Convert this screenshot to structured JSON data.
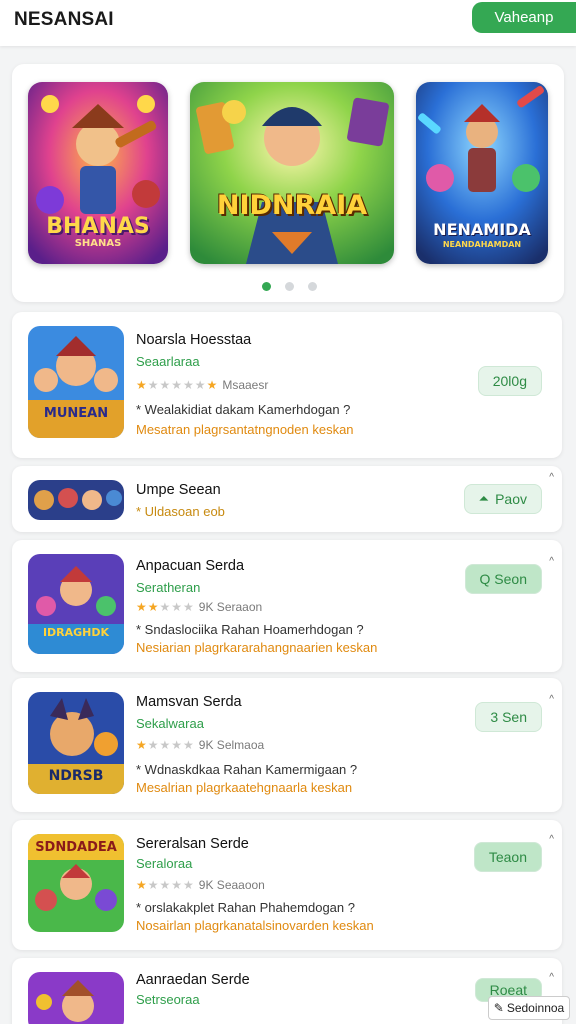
{
  "header": {
    "title": "NESANSAI",
    "action_label": "Vaheanp"
  },
  "carousel": {
    "slides": [
      {
        "text": "BHANAS",
        "subtext": "SHANAS"
      },
      {
        "text": "NIDNRAIA",
        "subtext": ""
      },
      {
        "text": "NENAMIDA",
        "subtext": "NEANDAHAMDAN"
      }
    ],
    "dots": 3,
    "active_dot": 0
  },
  "list": [
    {
      "title": "Noarsla Hoesstaa",
      "subtitle": "Seaarlaraa",
      "rating_stars": "★★★★★★★",
      "rating_text": "Msaaesr",
      "description": "* Wealakidiat dakam Kamerhdogan ?",
      "link": "Mesatran plagrsantatngnoden keskan",
      "action": "20l0g",
      "thumb_text": "MUNEAN"
    },
    {
      "title": "Umpe Seean",
      "subtitle": "* Uldasoan eob",
      "action": "Paov",
      "action_icon": "upload-icon",
      "thumb_text": ""
    },
    {
      "title": "Anpacuan Serda",
      "subtitle": "Seratheran",
      "rating_stars": "★★★★★",
      "rating_text": "9K Seraaon",
      "description": "* Sndaslociika Rahan Hoamerhdogan ?",
      "link": "Nesiarian plagrkararahangnaarien keskan",
      "action": "Q Seon",
      "thumb_text": "IDRAGHDK"
    },
    {
      "title": "Mamsvan Serda",
      "subtitle": "Sekalwaraa",
      "rating_stars": "★★★★★",
      "rating_text": "9K Selmaoa",
      "description": "* Wdnaskdkaa Rahan Kamermigaan ?",
      "link": "Mesalrian plagrkaatehgnaarla keskan",
      "action": "3 Sen",
      "thumb_text": "NDRSB"
    },
    {
      "title": "Sereralsan Serde",
      "subtitle": "Seraloraa",
      "rating_stars": "★★★★★",
      "rating_text": "9K Seaaoon",
      "description": "* orslakakplet Rahan Phahemdogan ?",
      "link": "Nosairlan plagrkanatalsinovarden keskan",
      "action": "Teaon",
      "thumb_text": "SDNDADEA"
    },
    {
      "title": "Aanraedan Serde",
      "subtitle": "Setrseoraa",
      "action": "Roeat",
      "thumb_text": ""
    }
  ],
  "footer": {
    "corner_label": "Sedoinnoa"
  },
  "colors": {
    "accent": "#34a853",
    "link": "#e08a10",
    "star": "#f5a623"
  }
}
